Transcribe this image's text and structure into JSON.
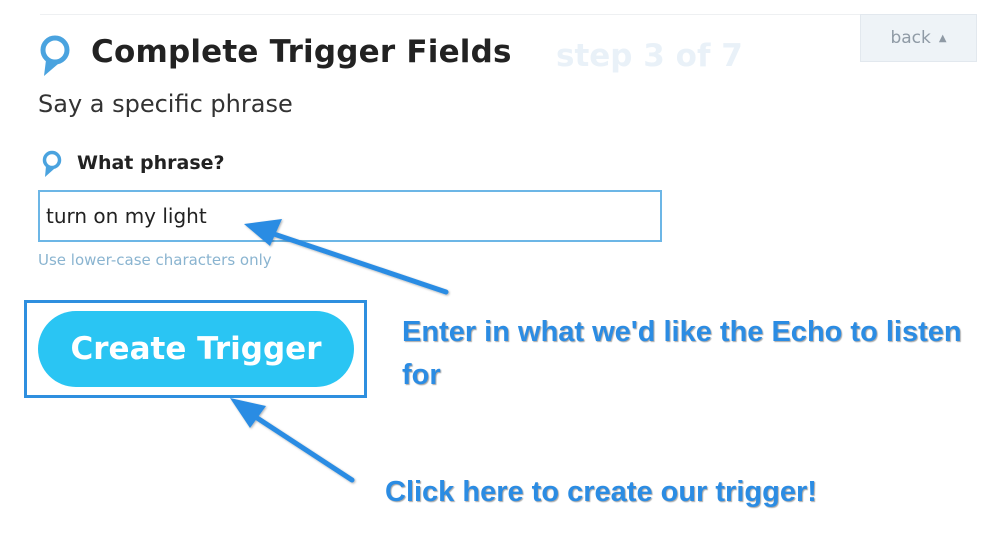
{
  "header": {
    "title": "Complete Trigger Fields",
    "step": "step 3 of 7",
    "subtitle": "Say a specific phrase",
    "back_label": "back",
    "header_icon": "alexa-ring-icon"
  },
  "field": {
    "label": "What phrase?",
    "value": "turn on my light",
    "helper": "Use lower-case characters only",
    "field_icon": "alexa-ring-icon"
  },
  "actions": {
    "create_label": "Create Trigger"
  },
  "annotations": {
    "input_note": "Enter in what we'd like the Echo to listen for",
    "button_note": "Click here to create our trigger!",
    "arrow_icon": "arrow-icon"
  },
  "colors": {
    "accent": "#2ac5f3",
    "annotation": "#2b8ce3",
    "icon": "#4aa3df"
  }
}
